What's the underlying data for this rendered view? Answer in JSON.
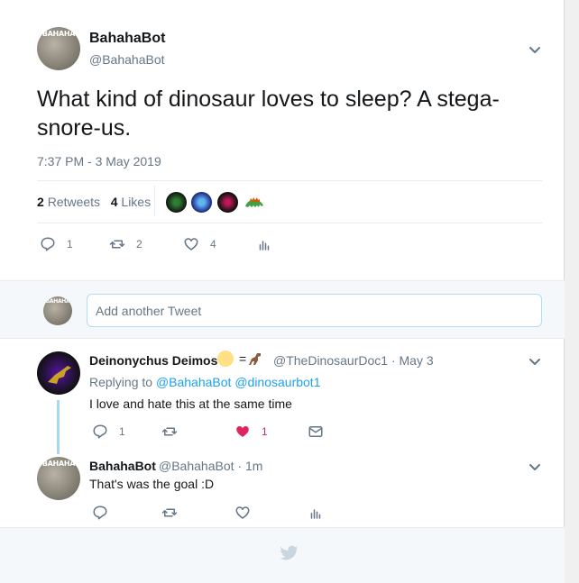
{
  "tweet": {
    "author_name": "BahahaBot",
    "author_handle": "@BahahaBot",
    "avatar_text": "BAHAHA",
    "text": "What kind of dinosaur loves to sleep? A stega-snore-us.",
    "timestamp": "7:37 PM - 3 May 2019",
    "retweets_count": "2",
    "retweets_label": "Retweets",
    "likes_count": "4",
    "likes_label": "Likes",
    "actions": {
      "reply_count": "1",
      "retweet_count": "2",
      "like_count": "4"
    }
  },
  "reply_box": {
    "placeholder": "Add another Tweet"
  },
  "replies": [
    {
      "author_name": "Deinonychus Deimos",
      "emoji_extra": "= ",
      "author_handle": "@TheDinosaurDoc1",
      "time": "· May 3",
      "replying_prefix": "Replying to",
      "replying_to": "@BahahaBot @dinosaurbot1",
      "text": "I love and hate this at the same time",
      "reply_count": "1",
      "like_count": "1"
    },
    {
      "author_name": "BahahaBot",
      "author_handle": "@BahahaBot",
      "time": "· 1m",
      "text": "That's was the goal :D"
    }
  ],
  "colors": {
    "accent": "#1da1f2",
    "like_active": "#e0245e",
    "muted": "#657786"
  },
  "icons": [
    "chevron-down-icon",
    "reply-icon",
    "retweet-icon",
    "heart-icon",
    "stats-icon",
    "mail-icon",
    "twitter-bird-icon"
  ]
}
